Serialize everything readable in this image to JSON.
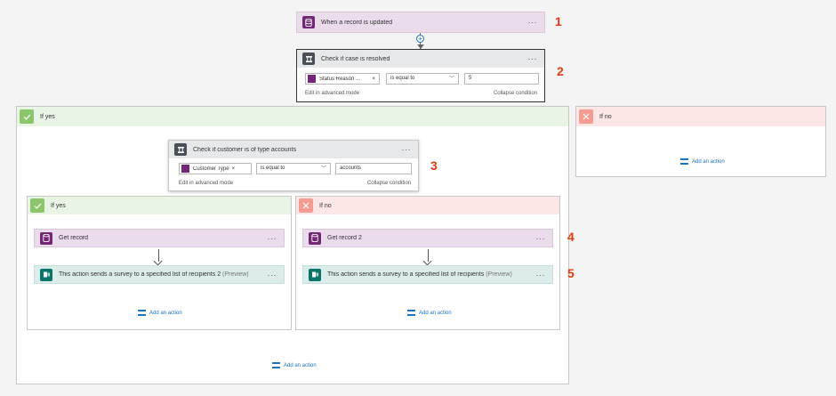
{
  "trigger": {
    "title": "When a record is updated",
    "menu": "···"
  },
  "condition1": {
    "title": "Check if case is resolved",
    "menu": "···",
    "field_chip": "Status Reason ...",
    "chip_remove": "×",
    "operator": "is equal to",
    "value": "5",
    "advanced": "Edit in advanced mode",
    "collapse": "Collapse condition"
  },
  "branch_yes": {
    "label": "If yes",
    "add_action": "Add an action"
  },
  "branch_no": {
    "label": "If no",
    "add_action": "Add an action"
  },
  "condition2": {
    "title": "Check if customer is of type accounts",
    "menu": "···",
    "field_chip": "Customer Type",
    "chip_remove": "×",
    "operator": "is equal to",
    "value": "accounts",
    "advanced": "Edit in advanced mode",
    "collapse": "Collapse condition"
  },
  "inner_yes": {
    "label": "If yes",
    "get_record": "Get record",
    "survey": "This action sends a survey to a specified list of recipients 2",
    "preview": "(Preview)",
    "add_action": "Add an action"
  },
  "inner_no": {
    "label": "If no",
    "get_record": "Get record 2",
    "survey": "This action sends a survey to a specified list of recipients",
    "preview": "(Preview)",
    "add_action": "Add an action"
  },
  "markers": [
    "1",
    "2",
    "3",
    "4",
    "5"
  ],
  "colors": {
    "dynamics": "#742774",
    "condition": "#484f58",
    "forms": "#077568",
    "yes_bg": "#e8f5e4",
    "yes_icon": "#8cc56c",
    "no_bg": "#fde7e6",
    "no_icon": "#f49c92",
    "link": "#1a73c7",
    "marker": "#e8380d"
  }
}
